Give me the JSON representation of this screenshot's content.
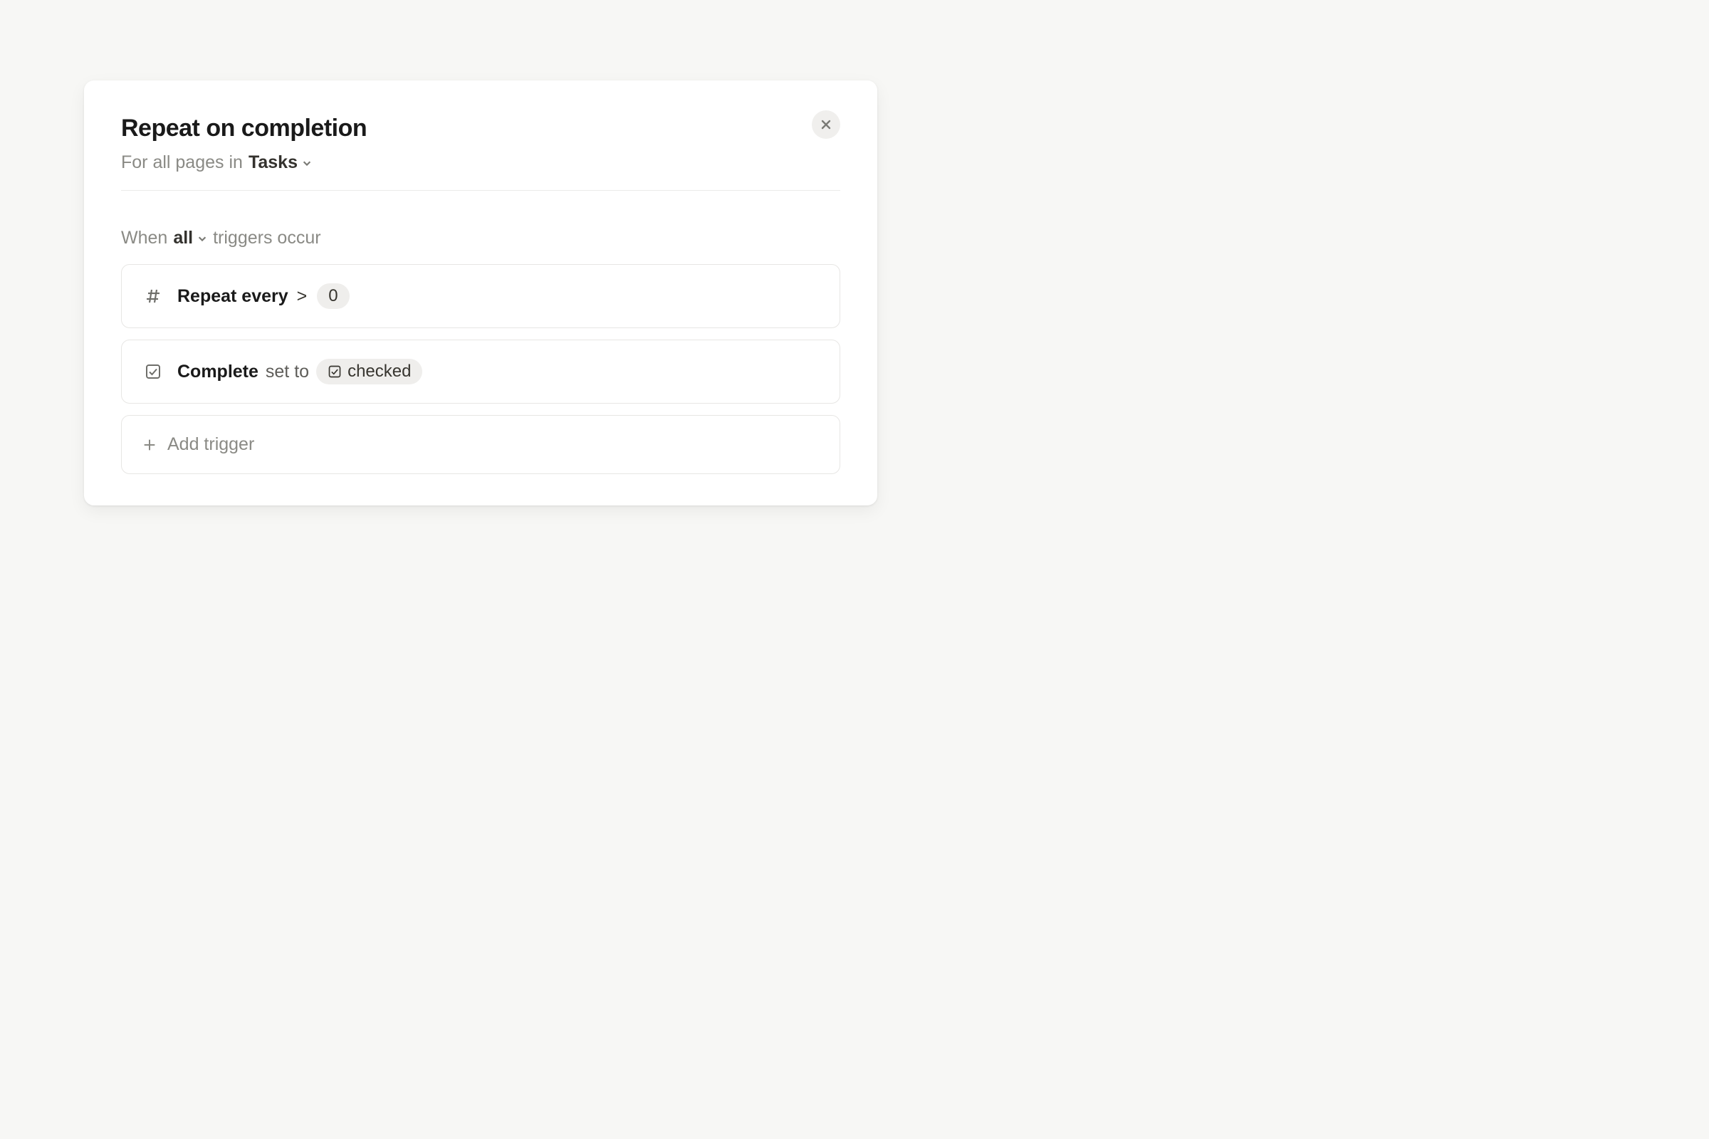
{
  "title": "Repeat on completion",
  "subheader": {
    "prefix": "For all pages in",
    "scope": "Tasks"
  },
  "triggers_header": {
    "when": "When",
    "quantifier": "all",
    "suffix": "triggers occur"
  },
  "triggers": [
    {
      "property": "Repeat every",
      "operator": ">",
      "value": "0"
    },
    {
      "property": "Complete",
      "relation": "set to",
      "value": "checked"
    }
  ],
  "add_trigger_label": "Add trigger"
}
